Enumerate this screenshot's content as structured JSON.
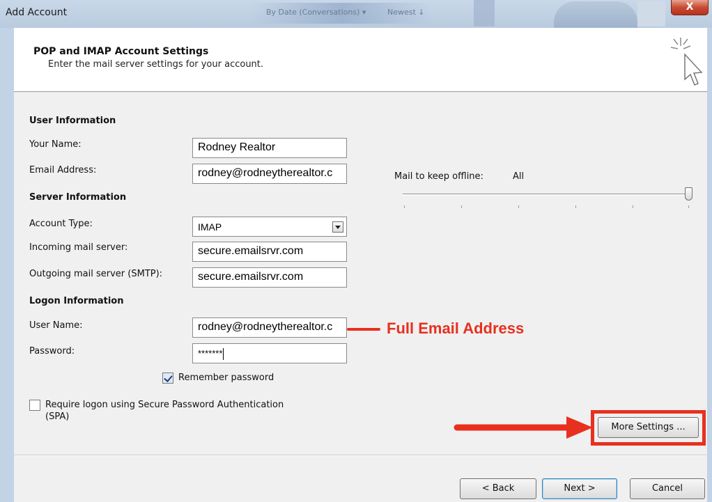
{
  "window": {
    "title": "Add Account",
    "close_label": "X",
    "background_fragments": [
      "By Date (Conversations) ▾",
      "Newest ↓"
    ]
  },
  "header": {
    "title": "POP and IMAP Account Settings",
    "subtitle": "Enter the mail server settings for your account."
  },
  "user_information": {
    "heading": "User Information",
    "your_name_label": "Your Name:",
    "your_name_value": "Rodney Realtor",
    "email_label": "Email Address:",
    "email_value": "rodney@rodneytherealtor.c"
  },
  "server_information": {
    "heading": "Server Information",
    "account_type_label": "Account Type:",
    "account_type_value": "IMAP",
    "incoming_label": "Incoming mail server:",
    "incoming_value": "secure.emailsrvr.com",
    "outgoing_label": "Outgoing mail server (SMTP):",
    "outgoing_value": "secure.emailsrvr.com"
  },
  "logon_information": {
    "heading": "Logon Information",
    "username_label": "User Name:",
    "username_value": "rodney@rodneytherealtor.c",
    "password_label": "Password:",
    "password_value": "*******",
    "remember_label": "Remember password",
    "remember_checked": true,
    "spa_label_line1": "Require logon using Secure Password Authentication",
    "spa_label_line2": "(SPA)",
    "spa_checked": false
  },
  "offline": {
    "label": "Mail to keep offline:",
    "value": "All",
    "slider_fraction": 1.0
  },
  "annotation": {
    "text": "Full Email Address",
    "color": "#e8301f"
  },
  "buttons": {
    "more_settings": "More Settings ...",
    "back": "< Back",
    "next": "Next >",
    "cancel": "Cancel"
  },
  "icons": [
    "cursor-sparkle-icon",
    "close-icon",
    "dropdown-arrow-icon",
    "checkmark-icon"
  ]
}
